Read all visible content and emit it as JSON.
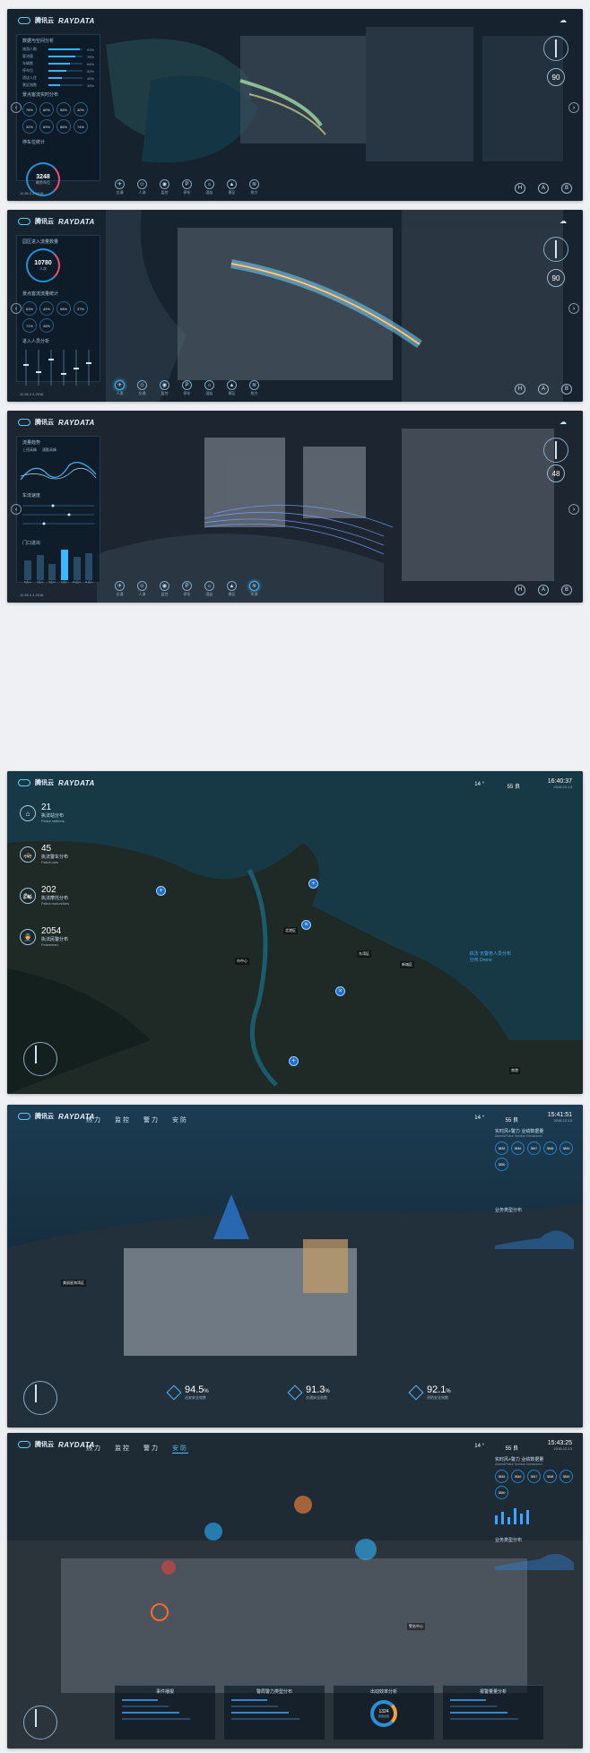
{
  "brand": {
    "cn": "腾讯云",
    "en": "RAYDATA"
  },
  "panels": [
    {
      "id": "p1",
      "section_title": "数据与空间分析",
      "bars": [
        {
          "label": "旅游人数",
          "pct": "91%",
          "fill": 0.91
        },
        {
          "label": "客流量",
          "pct": "78%",
          "fill": 0.78
        },
        {
          "label": "车辆数",
          "pct": "64%",
          "fill": 0.64
        },
        {
          "label": "停车位",
          "pct": "52%",
          "fill": 0.52
        },
        {
          "label": "酒店入住",
          "pct": "40%",
          "fill": 0.4
        },
        {
          "label": "景区指数",
          "pct": "35%",
          "fill": 0.35
        }
      ],
      "rings_title": "景点客流实时分布",
      "rings": [
        "78%",
        "80%",
        "56%",
        "40%",
        "32%",
        "69%",
        "86%",
        "74%"
      ],
      "gauge_title": "停车位统计",
      "gauge_value": "3248",
      "gauge_unit": "剩余车位",
      "footer": "11:36  2.2.2016",
      "zoom": "90",
      "tools": [
        "交通",
        "人流",
        "监控",
        "停车",
        "酒店",
        "景区",
        "热力"
      ],
      "rtools": [
        "H",
        "A",
        "B"
      ]
    },
    {
      "id": "p2",
      "section_title": "园区进入流量数量",
      "gauge_value": "10780",
      "gauge_unit": "人次",
      "rings_title": "景点客流流量统计",
      "rings": [
        "63%",
        "42%",
        "58%",
        "37%",
        "71%",
        "46%"
      ],
      "sliders_title": "进入人员分析",
      "footer": "11:36  2.2.2016",
      "zoom": "90",
      "tools": [
        "人流",
        "交通",
        "监控",
        "停车",
        "酒店",
        "景区",
        "热力"
      ],
      "rtools": [
        "H",
        "A",
        "B"
      ],
      "active_tool": "人流"
    },
    {
      "id": "p3",
      "section_title": "流量趋势",
      "legend": [
        "上班高峰",
        "通勤高峰"
      ],
      "flow_title": "车流速度",
      "gate_title": "门口进出",
      "gate_labels": [
        "8点px",
        "7点px",
        "8点px",
        "9点px",
        "10点px",
        "11点px"
      ],
      "footer": "11:36  2.2.2016",
      "zoom": "48",
      "tools": [
        "交通",
        "人流",
        "监控",
        "停车",
        "酒店",
        "景区",
        "车流"
      ],
      "rtools": [
        "H",
        "A",
        "B"
      ],
      "active_tool": "车流"
    },
    {
      "id": "p4",
      "temp": "14 °",
      "aqi": "55 良",
      "time": "16:40:37",
      "date": "2016-12-13",
      "stats": [
        {
          "n": "21",
          "zh": "执法站分布",
          "en": "Police stations",
          "icon": "⌂"
        },
        {
          "n": "45",
          "zh": "执法警车分布",
          "en": "Patrol cars",
          "icon": "🚓"
        },
        {
          "n": "202",
          "zh": "执法摩托分布",
          "en": "Patrol motorbikes",
          "icon": "🏍"
        },
        {
          "n": "2054",
          "zh": "执法民警分布",
          "en": "Policeman",
          "icon": "👮"
        }
      ],
      "legend": [
        "执法   无警务人员分布",
        "分布   Drone"
      ],
      "places": [
        "市中心",
        "东湾区",
        "北港区",
        "新城区",
        "南港"
      ]
    },
    {
      "id": "p5",
      "nav": [
        "热",
        "力",
        "监",
        "控",
        "警",
        "力",
        "安",
        "防"
      ],
      "temp": "14 °",
      "aqi": "55 良",
      "time": "15:41:51",
      "date": "2016-12-13",
      "right_title": "实时风+警力 业绩数据量",
      "right_sub": "Alarm&Police Number Breakdown",
      "chips": [
        "3845",
        "3846",
        "3847",
        "3848",
        "3849",
        "3850"
      ],
      "chips_labels": [
        "1月份",
        "2月份",
        "3月份"
      ],
      "right_title2": "业务类型分布",
      "kpis": [
        {
          "v": "94.5",
          "u": "%",
          "l": "治安安全效数"
        },
        {
          "v": "91.3",
          "u": "%",
          "l": "交通安全效数"
        },
        {
          "v": "92.1",
          "u": "%",
          "l": "消防安全效数"
        }
      ],
      "place": "美丽星海湾区"
    },
    {
      "id": "p6",
      "nav": [
        "热",
        "力",
        "监",
        "控",
        "警",
        "力",
        "安",
        "防"
      ],
      "temp": "14 °",
      "aqi": "55 良",
      "time": "15:43:25",
      "date": "2016-12-13",
      "right_title": "实时风+警力 业绩数据量",
      "right_sub": "Alarm&Police Number Breakdown",
      "chips": [
        "3845",
        "3846",
        "3847",
        "3848",
        "3849",
        "3850"
      ],
      "right_title2": "业务类型分布",
      "bottom_panels": [
        "事件播报",
        "警局警力类型分布",
        "出动效率分析",
        "报警量量分析"
      ],
      "donut_value": "1324",
      "donut_label": "民警出警",
      "place": "警务中心"
    }
  ]
}
